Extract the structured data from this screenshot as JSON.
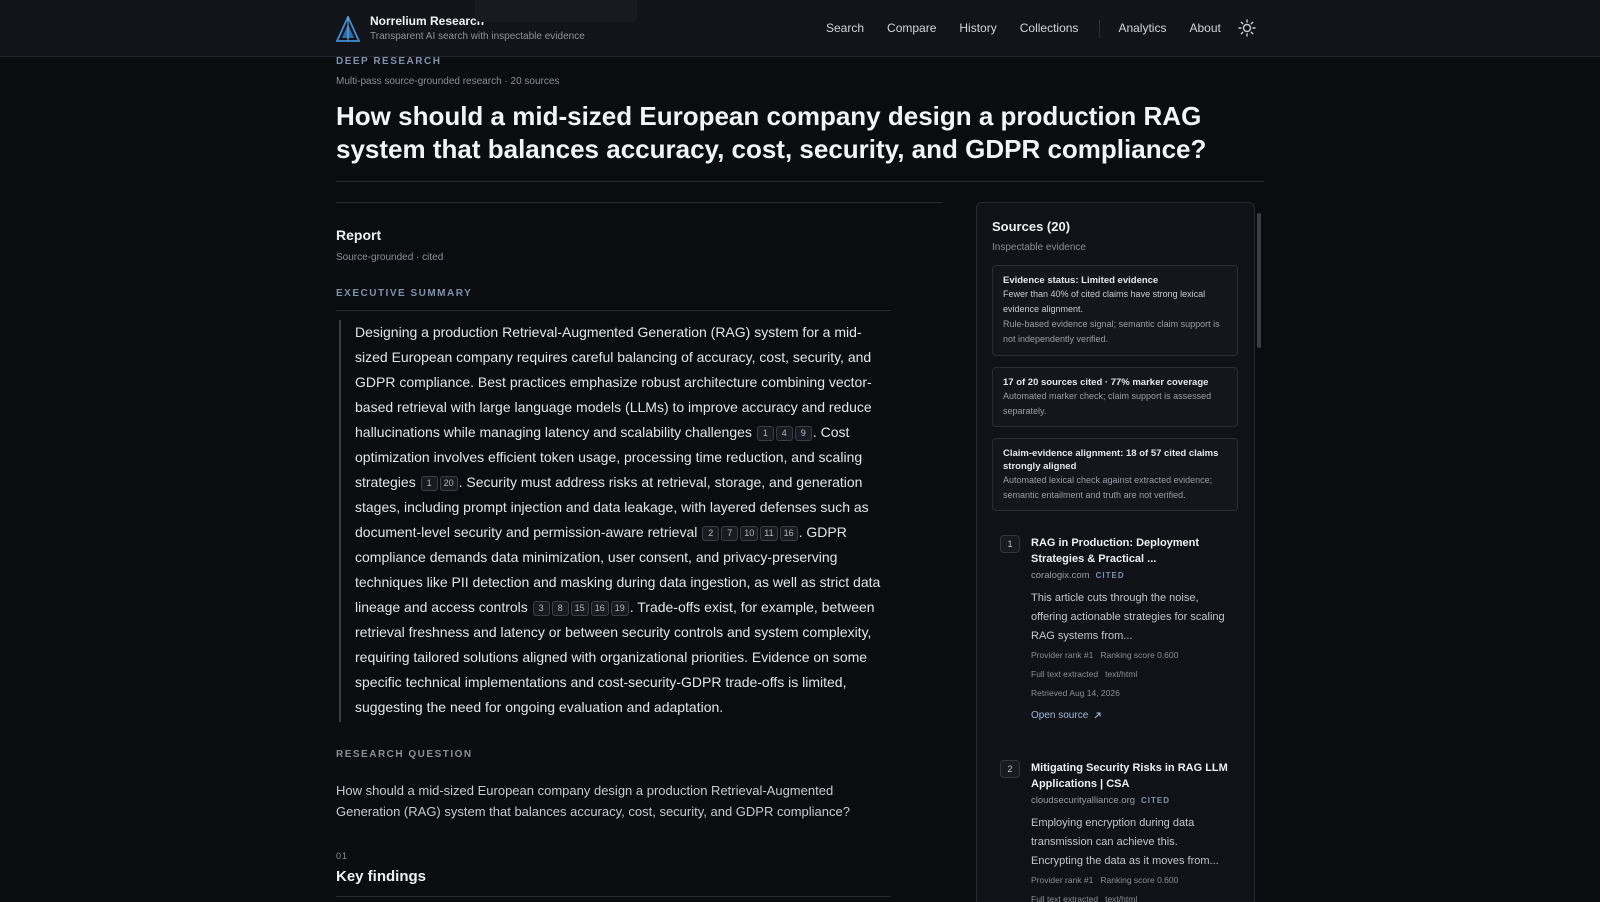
{
  "header": {
    "brand_name": "Norrelium Research",
    "brand_tagline": "Transparent AI search with inspectable evidence",
    "nav": [
      "Search",
      "Compare",
      "History",
      "Collections",
      "Analytics",
      "About"
    ],
    "theme_icon": "sun-icon"
  },
  "intro": {
    "eyebrow": "DEEP RESEARCH",
    "meta": "Multi-pass source-grounded research · 20 sources",
    "title": "How should a mid-sized European company design a production RAG system that balances accuracy, cost, security, and GDPR compliance?"
  },
  "report": {
    "title": "Report",
    "meta": "Source-grounded · cited",
    "exec_label": "EXECUTIVE SUMMARY",
    "summary": [
      {
        "t": "Designing a production Retrieval-Augmented Generation (RAG) system for a mid-sized European company requires careful balancing of accuracy, cost, security, and GDPR compliance. Best practices emphasize robust architecture combining vector-based retrieval with large language models (LLMs) to improve accuracy and reduce hallucinations while managing latency and scalability challenges"
      },
      {
        "c": [
          "1",
          "4",
          "9"
        ]
      },
      {
        "t": ". Cost optimization involves efficient token usage, processing time reduction, and scaling strategies"
      },
      {
        "c": [
          "1",
          "20"
        ]
      },
      {
        "t": ". Security must address risks at retrieval, storage, and generation stages, including prompt injection and data leakage, with layered defenses such as document-level security and permission-aware retrieval"
      },
      {
        "c": [
          "2",
          "7",
          "10",
          "11",
          "16"
        ]
      },
      {
        "t": ". GDPR compliance demands data minimization, user consent, and privacy-preserving techniques like PII detection and masking during data ingestion, as well as strict data lineage and access controls"
      },
      {
        "c": [
          "3",
          "8",
          "15",
          "16",
          "19"
        ]
      },
      {
        "t": ". Trade-offs exist, for example, between retrieval freshness and latency or between security controls and system complexity, requiring tailored solutions aligned with organizational priorities. Evidence on some specific technical implementations and cost-security-GDPR trade-offs is limited, suggesting the need for ongoing evaluation and adaptation."
      }
    ],
    "rq_label": "RESEARCH QUESTION",
    "rq_text": "How should a mid-sized European company design a production Retrieval-Augmented Generation (RAG) system that balances accuracy, cost, security, and GDPR compliance?",
    "kf_num": "01",
    "kf_title": "Key findings"
  },
  "sources": {
    "title": "Sources (20)",
    "subtitle": "Inspectable evidence",
    "evidence": [
      {
        "heading": "Evidence status: Limited evidence",
        "strong": "Fewer than 40% of cited claims have strong lexical evidence alignment.",
        "note": "Rule-based evidence signal; semantic claim support is not independently verified."
      },
      {
        "heading": "17 of 20 sources cited · 77% marker coverage",
        "note": "Automated marker check; claim support is assessed separately."
      },
      {
        "heading": "Claim-evidence alignment: 18 of 57 cited claims strongly aligned",
        "note": "Automated lexical check against extracted evidence; semantic entailment and truth are not verified."
      }
    ],
    "items": [
      {
        "num": "1",
        "title": "RAG in Production: Deployment Strategies & Practical ...",
        "domain": "coralogix.com",
        "badge": "CITED",
        "desc": "This article cuts through the noise, offering actionable strategies for scaling RAG systems from...",
        "rank": "Provider rank #1",
        "score": "Ranking score 0.600",
        "extract": "Full text extracted",
        "mime": "text/html",
        "retrieved": "Retrieved Aug 14, 2026",
        "open": "Open source"
      },
      {
        "num": "2",
        "title": "Mitigating Security Risks in RAG LLM Applications | CSA",
        "domain": "cloudsecurityalliance.org",
        "badge": "CITED",
        "desc": "Employing encryption during data transmission can achieve this. Encrypting the data as it moves from...",
        "rank": "Provider rank #1",
        "score": "Ranking score 0.600",
        "extract": "Full text extracted",
        "mime": "text/html"
      }
    ]
  }
}
